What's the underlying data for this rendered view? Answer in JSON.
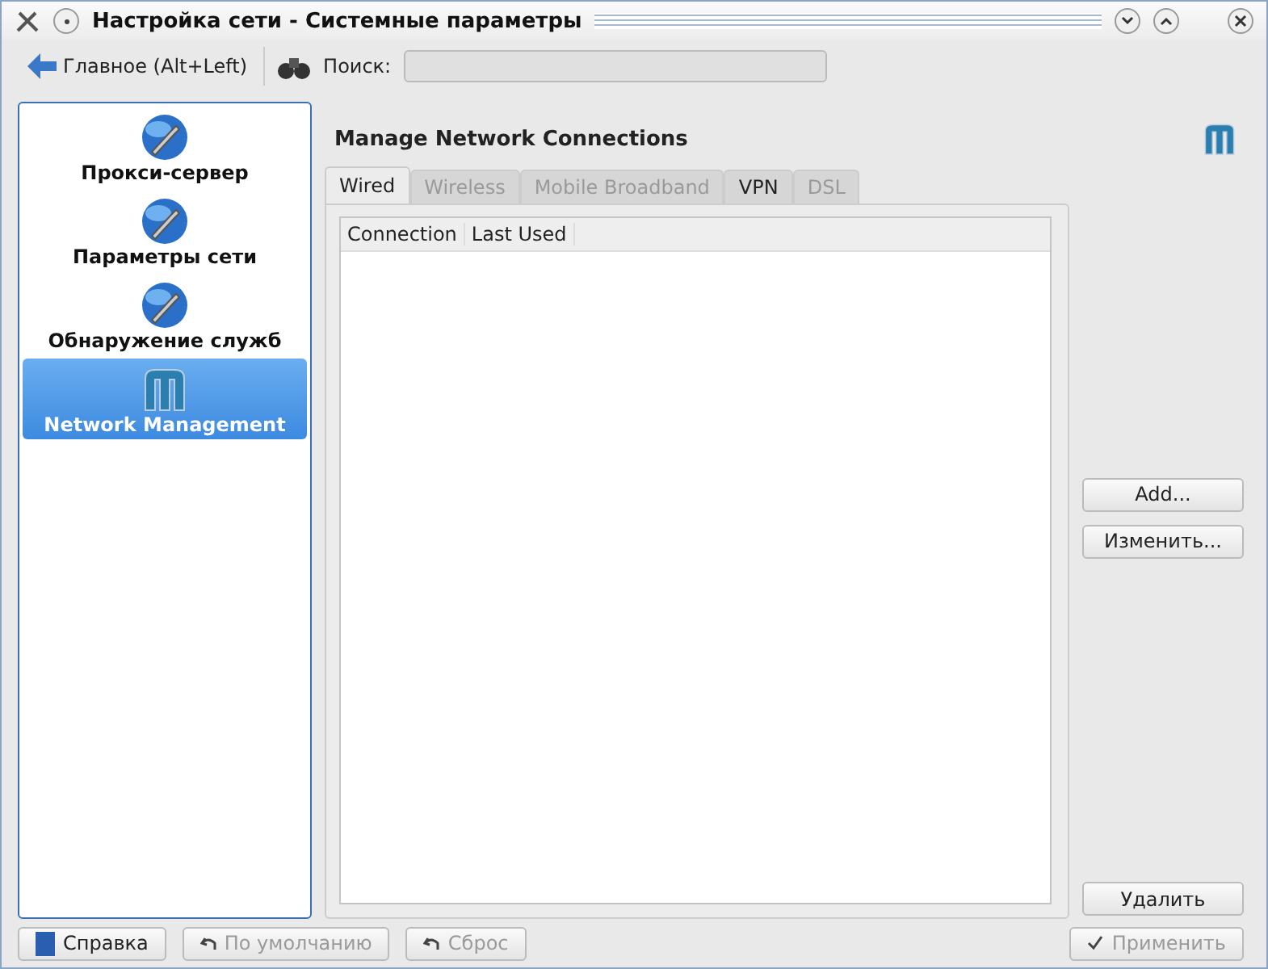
{
  "window": {
    "title": "Настройка сети - Системные параметры"
  },
  "toolbar": {
    "back": "Главное (Alt+Left)",
    "search_label": "Поиск:"
  },
  "sidebar": {
    "items": [
      {
        "label": "Прокси-сервер",
        "kind": "globe",
        "selected": false
      },
      {
        "label": "Параметры сети",
        "kind": "globe",
        "selected": false
      },
      {
        "label": "Обнаружение служб",
        "kind": "globe",
        "selected": false
      },
      {
        "label": "Network Management",
        "kind": "network",
        "selected": true
      }
    ]
  },
  "content": {
    "heading": "Manage Network Connections",
    "tabs": [
      {
        "label": "Wired",
        "selected": true,
        "disabled": false
      },
      {
        "label": "Wireless",
        "selected": false,
        "disabled": true
      },
      {
        "label": "Mobile Broadband",
        "selected": false,
        "disabled": true
      },
      {
        "label": "VPN",
        "selected": false,
        "disabled": false
      },
      {
        "label": "DSL",
        "selected": false,
        "disabled": true
      }
    ],
    "table": {
      "columns": [
        "Connection",
        "Last Used"
      ]
    },
    "side_buttons": [
      {
        "label": "Add...",
        "disabled": false
      },
      {
        "label": "Изменить...",
        "disabled": false
      }
    ],
    "delete_button": {
      "label": "Удалить",
      "disabled": false
    }
  },
  "footer": {
    "buttons": [
      {
        "label": "Справка",
        "kind": "help",
        "disabled": false
      },
      {
        "label": "По умолчанию",
        "kind": "defaults",
        "disabled": true
      },
      {
        "label": "Сброс",
        "kind": "reset",
        "disabled": true
      },
      {
        "label": "Применить",
        "kind": "apply",
        "disabled": true
      }
    ]
  }
}
